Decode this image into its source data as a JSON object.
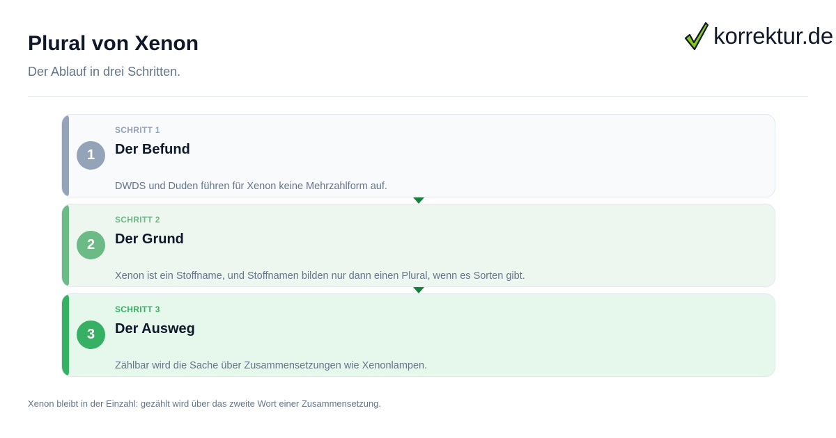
{
  "header": {
    "title": "Plural von Xenon",
    "subtitle": "Der Ablauf in drei Schritten."
  },
  "logo": {
    "text": "korrektur.de",
    "icon": "checkmark-icon",
    "colors": {
      "check_fill": "#84cc16",
      "check_stroke": "#111827"
    }
  },
  "steps": [
    {
      "number": "1",
      "kicker": "SCHRITT 1",
      "title": "Der Befund",
      "text": "DWDS und Duden führen für Xenon keine Mehrzahlform auf.",
      "color": "#94a3b8"
    },
    {
      "number": "2",
      "kicker": "SCHRITT 2",
      "title": "Der Grund",
      "text": "Xenon ist ein Stoffname, und Stoffnamen bilden nur dann einen Plural, wenn es Sorten gibt.",
      "color": "#6cba86"
    },
    {
      "number": "3",
      "kicker": "SCHRITT 3",
      "title": "Der Ausweg",
      "text": "Zählbar wird die Sache über Zusammensetzungen wie Xenonlampen.",
      "color": "#36b063"
    }
  ],
  "connector_color": "#15803d",
  "footnote": "Xenon bleibt in der Einzahl: gezählt wird über das zweite Wort einer Zusammensetzung."
}
